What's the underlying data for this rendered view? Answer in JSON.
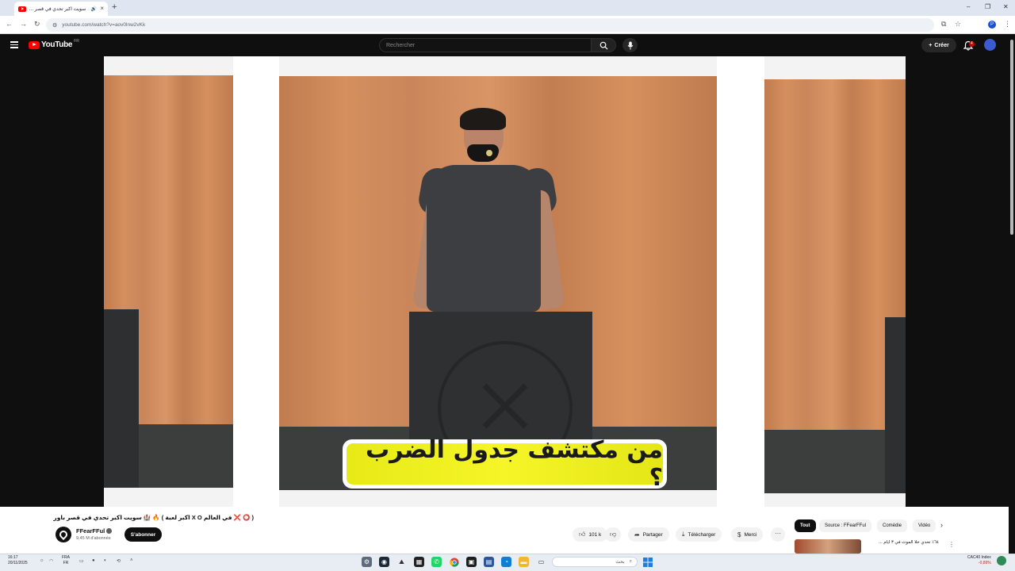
{
  "browser": {
    "tab_title": "سويت اكبر تحدي في قصر ...",
    "tab_audio": "🔊",
    "new_tab": "+",
    "url": "youtube.com/watch?v=aov0lnw2vKk",
    "profile_initial": "P",
    "window_controls": [
      "–",
      "❐",
      "✕"
    ]
  },
  "youtube": {
    "logo_text": "YouTube",
    "country_code": "FR",
    "search_placeholder": "Rechercher",
    "create_label": "Créer",
    "notification_count": "4"
  },
  "video": {
    "caption_text": "من مكتشف جدول الضرب ؟",
    "title": "( ⭕ ❌ في العالم X O اكبر لعبة ) 🔥 🏰 سويت اكبر تحدي في قصر باور",
    "channel_name": "FFearFFul",
    "subscribers": "9,45 M d'abonnés",
    "subscribe_label": "S'abonner",
    "likes": "101 k",
    "share_label": "Partager",
    "download_label": "Télécharger",
    "thanks_label": "Merci",
    "more_label": "···"
  },
  "sidebar": {
    "chips": [
      "Tout",
      "Source : FFearFFul",
      "Comédie",
      "Vidéo"
    ],
    "rec_title": "٦٤٪ تحدي خلا الموت في ٣ أيام ..."
  },
  "taskbar": {
    "time": "16:17",
    "date": "20/11/2025",
    "lang_top": "FRA",
    "lang_bottom": "FR",
    "search_placeholder": "بحث",
    "market_name": "CAC40 Index",
    "market_change": "-0,89%"
  },
  "colors": {
    "youtube_red": "#ff0000",
    "caption_yellow": "#f5f528",
    "page_dark": "#0f0f0f"
  }
}
